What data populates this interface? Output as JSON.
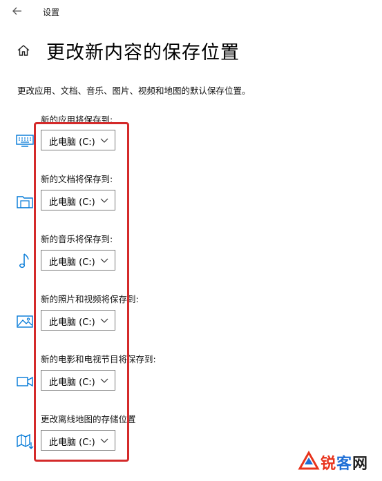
{
  "window": {
    "title": "设置"
  },
  "page": {
    "title": "更改新内容的保存位置",
    "description": "更改应用、文档、音乐、图片、视频和地图的默认保存位置。"
  },
  "sections": [
    {
      "label": "新的应用将保存到:",
      "value": "此电脑 (C:)",
      "icon": "keyboard-icon"
    },
    {
      "label": "新的文档将保存到:",
      "value": "此电脑 (C:)",
      "icon": "folder-icon"
    },
    {
      "label": "新的音乐将保存到:",
      "value": "此电脑 (C:)",
      "icon": "music-note-icon"
    },
    {
      "label": "新的照片和视频将保存到:",
      "value": "此电脑 (C:)",
      "icon": "picture-icon"
    },
    {
      "label": "新的电影和电视节目将保存到:",
      "value": "此电脑 (C:)",
      "icon": "video-camera-icon"
    },
    {
      "label": "更改离线地图的存储位置",
      "value": "此电脑 (C:)",
      "icon": "map-icon"
    }
  ],
  "watermark": {
    "part1": "锐",
    "part2": "客",
    "part3": "网"
  },
  "colors": {
    "accent": "#0078d7",
    "highlight": "#d42a2a"
  }
}
